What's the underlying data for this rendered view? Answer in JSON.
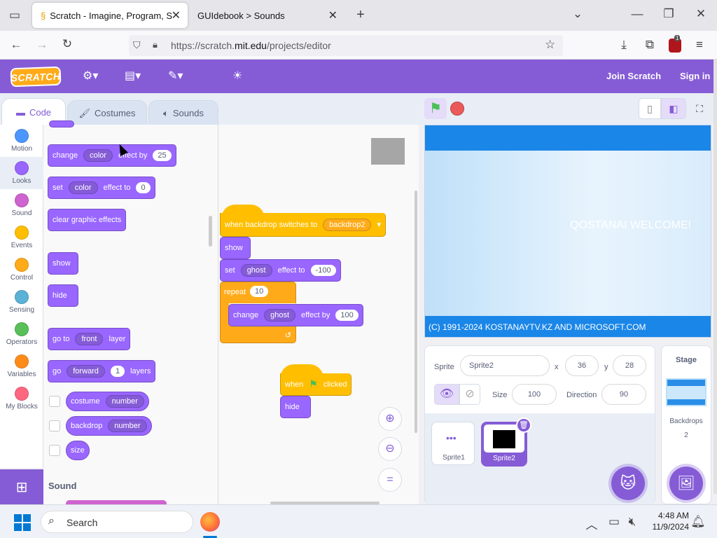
{
  "browser": {
    "tab1_title": "Scratch - Imagine, Program, Sh",
    "tab2_title": "GUIdebook > Sounds",
    "url": "https://scratch.mit.edu/projects/editor",
    "url_plain_prefix": "https://scratch.",
    "url_domain": "mit.edu",
    "url_path": "/projects/editor",
    "ext_badge": "1"
  },
  "menu": {
    "logo": "SCRATCH",
    "join": "Join Scratch",
    "signin": "Sign in"
  },
  "editor_tabs": {
    "code": "Code",
    "costumes": "Costumes",
    "sounds": "Sounds"
  },
  "categories": [
    {
      "label": "Motion",
      "color": "#4c97ff"
    },
    {
      "label": "Looks",
      "color": "#9966ff"
    },
    {
      "label": "Sound",
      "color": "#cf63cf"
    },
    {
      "label": "Events",
      "color": "#ffbf00"
    },
    {
      "label": "Control",
      "color": "#ffab19"
    },
    {
      "label": "Sensing",
      "color": "#5cb1d6"
    },
    {
      "label": "Operators",
      "color": "#59c059"
    },
    {
      "label": "Variables",
      "color": "#ff8c1a"
    },
    {
      "label": "My Blocks",
      "color": "#ff6680"
    }
  ],
  "palette": {
    "change_effect": {
      "t1": "change",
      "drop": "color",
      "t2": "effect by",
      "val": "25"
    },
    "set_effect": {
      "t1": "set",
      "drop": "color",
      "t2": "effect to",
      "val": "0"
    },
    "clear": "clear graphic effects",
    "show": "show",
    "hide": "hide",
    "goto_layer": {
      "t1": "go to",
      "drop": "front",
      "t2": "layer"
    },
    "go_layers": {
      "t1": "go",
      "drop": "forward",
      "val": "1",
      "t2": "layers"
    },
    "costume": {
      "t1": "costume",
      "drop": "number"
    },
    "backdrop": {
      "t1": "backdrop",
      "drop": "number"
    },
    "size": "size",
    "sound_heading": "Sound"
  },
  "script": {
    "hat1": {
      "t1": "when backdrop switches to",
      "drop": "backdrop2"
    },
    "show": "show",
    "set": {
      "t1": "set",
      "drop": "ghost",
      "t2": "effect to",
      "val": "-100"
    },
    "repeat": {
      "t1": "repeat",
      "val": "10"
    },
    "change": {
      "t1": "change",
      "drop": "ghost",
      "t2": "effect by",
      "val": "100"
    },
    "hat2": {
      "t1": "when",
      "t2": "clicked"
    },
    "hide": "hide"
  },
  "stage": {
    "welcome": "QOSTANAI WELCOME!",
    "footer": "(C) 1991-2024 KOSTANAYTV.KZ AND MICROSOFT.COM"
  },
  "sprite_info": {
    "sprite_label": "Sprite",
    "sprite_name": "Sprite2",
    "x_label": "x",
    "x": "36",
    "y_label": "y",
    "y": "28",
    "size_label": "Size",
    "size": "100",
    "direction_label": "Direction",
    "direction": "90",
    "sprites": [
      "Sprite1",
      "Sprite2"
    ]
  },
  "stage_panel": {
    "title": "Stage",
    "backdrops_label": "Backdrops",
    "backdrops_count": "2"
  },
  "taskbar": {
    "search": "Search",
    "time": "4:48 AM",
    "date": "11/9/2024"
  }
}
